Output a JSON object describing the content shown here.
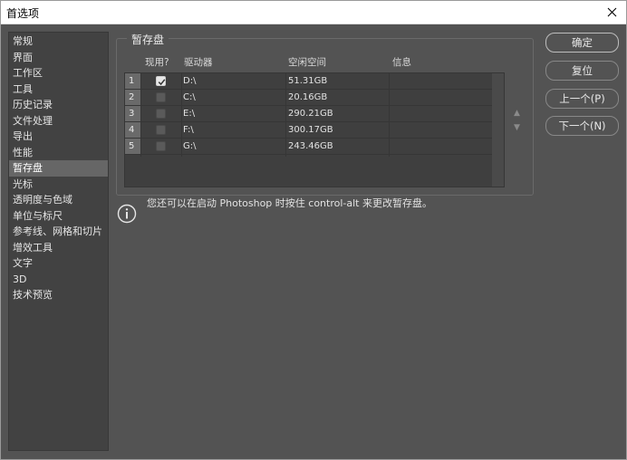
{
  "window": {
    "title": "首选项"
  },
  "sidebar": {
    "items": [
      {
        "label": "常规"
      },
      {
        "label": "界面"
      },
      {
        "label": "工作区"
      },
      {
        "label": "工具"
      },
      {
        "label": "历史记录"
      },
      {
        "label": "文件处理"
      },
      {
        "label": "导出"
      },
      {
        "label": "性能"
      },
      {
        "label": "暂存盘",
        "active": true
      },
      {
        "label": "光标"
      },
      {
        "label": "透明度与色域"
      },
      {
        "label": "单位与标尺"
      },
      {
        "label": "参考线、网格和切片"
      },
      {
        "label": "增效工具"
      },
      {
        "label": "文字"
      },
      {
        "label": "3D"
      },
      {
        "label": "技术预览"
      }
    ]
  },
  "scratch": {
    "group_label": "暂存盘",
    "headers": {
      "active": "现用?",
      "drive": "驱动器",
      "free": "空闲空间",
      "info": "信息"
    },
    "rows": [
      {
        "num": "1",
        "checked": true,
        "drive": "D:\\",
        "free": "51.31GB"
      },
      {
        "num": "2",
        "checked": false,
        "drive": "C:\\",
        "free": "20.16GB"
      },
      {
        "num": "3",
        "checked": false,
        "drive": "E:\\",
        "free": "290.21GB"
      },
      {
        "num": "4",
        "checked": false,
        "drive": "F:\\",
        "free": "300.17GB"
      },
      {
        "num": "5",
        "checked": false,
        "drive": "G:\\",
        "free": "243.46GB"
      }
    ],
    "note": "您还可以在启动 Photoshop 时按住 control-alt 来更改暂存盘。"
  },
  "buttons": {
    "ok": "确定",
    "reset": "复位",
    "prev": "上一个(P)",
    "next": "下一个(N)"
  },
  "colors": {
    "panel": "#535353",
    "sidebar": "#424242",
    "selected": "#666666"
  }
}
